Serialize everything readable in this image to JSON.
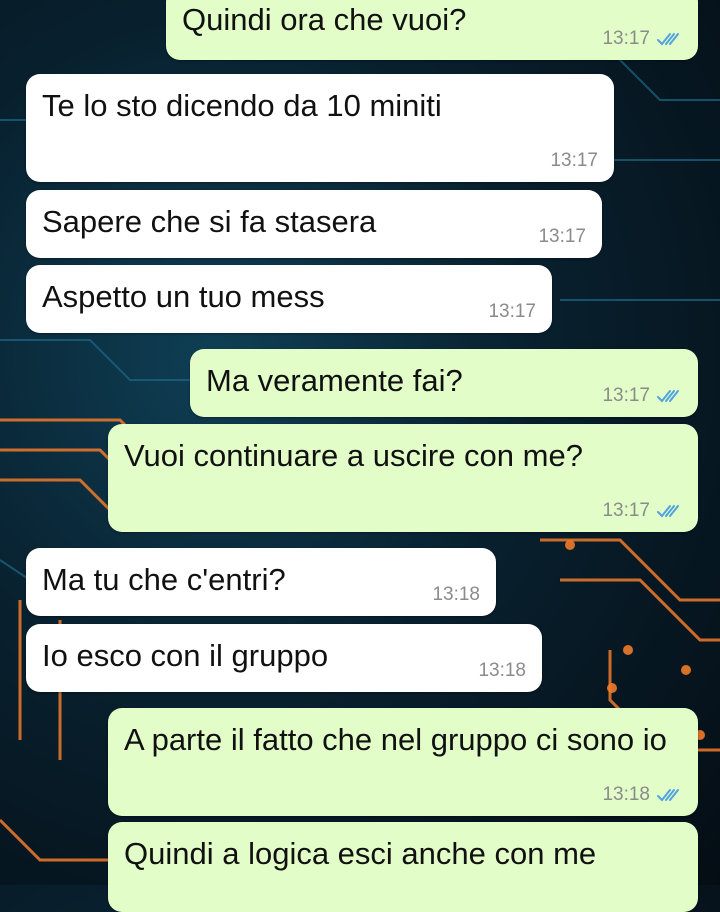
{
  "colors": {
    "incoming_bubble": "#ffffff",
    "outgoing_bubble": "#e2fdc8",
    "read_ticks": "#4fa3e0",
    "timestamp": "#8b8b8b",
    "wallpaper_circuit": "#f07a2a"
  },
  "messages": [
    {
      "direction": "outgoing",
      "text": "Quindi ora che vuoi?",
      "time": "13:17",
      "status": "read-ticks-icon"
    },
    {
      "direction": "incoming",
      "text": "Te lo sto dicendo da 10 miniti",
      "time": "13:17"
    },
    {
      "direction": "incoming",
      "text": "Sapere che si fa stasera",
      "time": "13:17"
    },
    {
      "direction": "incoming",
      "text": "Aspetto un tuo mess",
      "time": "13:17"
    },
    {
      "direction": "outgoing",
      "text": "Ma veramente fai?",
      "time": "13:17",
      "status": "read-ticks-icon"
    },
    {
      "direction": "outgoing",
      "text": "Vuoi continuare a uscire con me?",
      "time": "13:17",
      "status": "read-ticks-icon"
    },
    {
      "direction": "incoming",
      "text": "Ma tu che c'entri?",
      "time": "13:18"
    },
    {
      "direction": "incoming",
      "text": "Io esco con il gruppo",
      "time": "13:18"
    },
    {
      "direction": "outgoing",
      "text": "A parte il fatto che nel gruppo ci sono io",
      "time": "13:18",
      "status": "read-ticks-icon"
    },
    {
      "direction": "outgoing",
      "text": "Quindi a logica esci anche con me"
    }
  ]
}
